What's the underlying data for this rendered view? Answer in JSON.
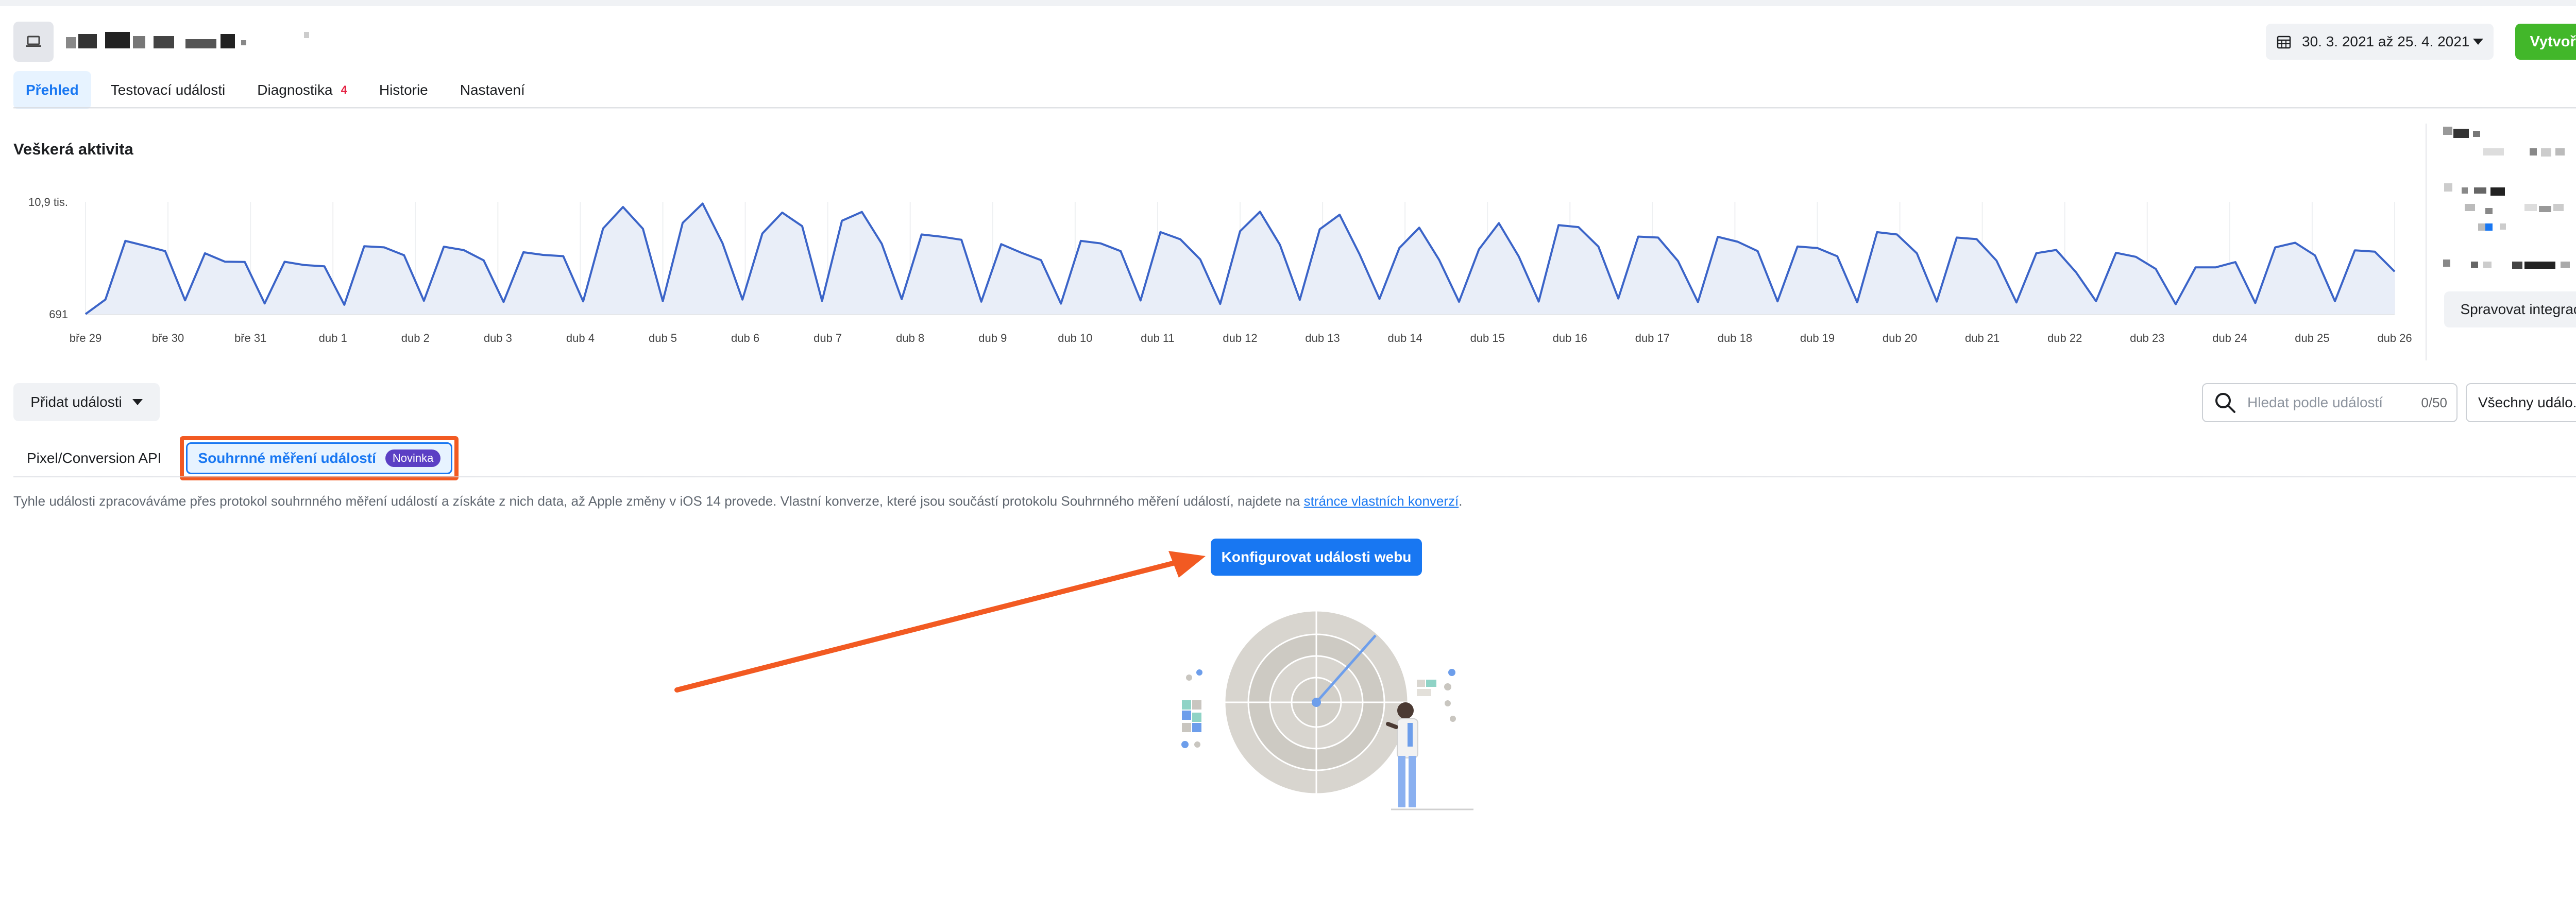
{
  "header": {
    "date_range": "30. 3. 2021 až 25. 4. 2021",
    "create_label": "Vytvořit"
  },
  "tabs": [
    {
      "label": "Přehled",
      "active": true
    },
    {
      "label": "Testovací události"
    },
    {
      "label": "Diagnostika",
      "badge": "4"
    },
    {
      "label": "Historie"
    },
    {
      "label": "Nastavení"
    }
  ],
  "activity": {
    "title": "Veškerá aktivita",
    "manage_integrations_label": "Spravovat integrace"
  },
  "chart_data": {
    "type": "area",
    "title": "Veškerá aktivita",
    "y_tick_labels": [
      "10,9 tis.",
      "691"
    ],
    "ylim": [
      691,
      10900
    ],
    "x_labels": [
      "bře 29",
      "bře 30",
      "bře 31",
      "dub 1",
      "dub 2",
      "dub 3",
      "dub 4",
      "dub 5",
      "dub 6",
      "dub 7",
      "dub 8",
      "dub 9",
      "dub 10",
      "dub 11",
      "dub 12",
      "dub 13",
      "dub 14",
      "dub 15",
      "dub 16",
      "dub 17",
      "dub 18",
      "dub 19",
      "dub 20",
      "dub 21",
      "dub 22",
      "dub 23",
      "dub 24",
      "dub 25",
      "dub 26"
    ],
    "values": [
      691,
      2010,
      7350,
      6900,
      6420,
      1940,
      6220,
      5460,
      5430,
      1660,
      5450,
      5150,
      5030,
      1540,
      6860,
      6760,
      6050,
      1900,
      6820,
      6510,
      5580,
      1790,
      6320,
      6070,
      5960,
      1850,
      8480,
      10430,
      8450,
      1860,
      8990,
      10740,
      7140,
      2010,
      8020,
      9920,
      8690,
      1890,
      9180,
      9980,
      7090,
      2050,
      7930,
      7730,
      7450,
      1820,
      7050,
      6280,
      5600,
      1640,
      7350,
      7120,
      6420,
      1930,
      8150,
      7490,
      5660,
      1620,
      8230,
      10000,
      7000,
      1990,
      8410,
      9730,
      6140,
      2070,
      6700,
      8550,
      5620,
      1810,
      6580,
      8960,
      5930,
      1830,
      8780,
      8600,
      6830,
      2110,
      7740,
      7650,
      5520,
      1780,
      7720,
      7270,
      6420,
      1850,
      6840,
      6700,
      5950,
      1760,
      8140,
      7930,
      6210,
      1830,
      7650,
      7510,
      5550,
      1750,
      6230,
      6520,
      4480,
      1860,
      6270,
      5900,
      4800,
      1590,
      4940,
      4940,
      5420,
      1700,
      6760,
      7180,
      6030,
      1860,
      6490,
      6370,
      4560
    ]
  },
  "events": {
    "add_events_label": "Přidat události",
    "search_placeholder": "Hledat podle událostí",
    "search_count": "0/50",
    "filter_label": "Všechny událo...",
    "subtab_pixel": "Pixel/Conversion API",
    "subtab_aem": "Souhrnné měření událostí",
    "new_badge": "Novinka",
    "info_text": "Tyhle události zpracováváme přes protokol souhrnného měření událostí a získáte z nich data, až Apple změny v iOS 14 provede. Vlastní konverze, které jsou součástí protokolu Souhrnného měření událostí, najdete na ",
    "info_link": "stránce vlastních konverzí",
    "info_end": ".",
    "configure_label": "Konfigurovat události webu"
  }
}
